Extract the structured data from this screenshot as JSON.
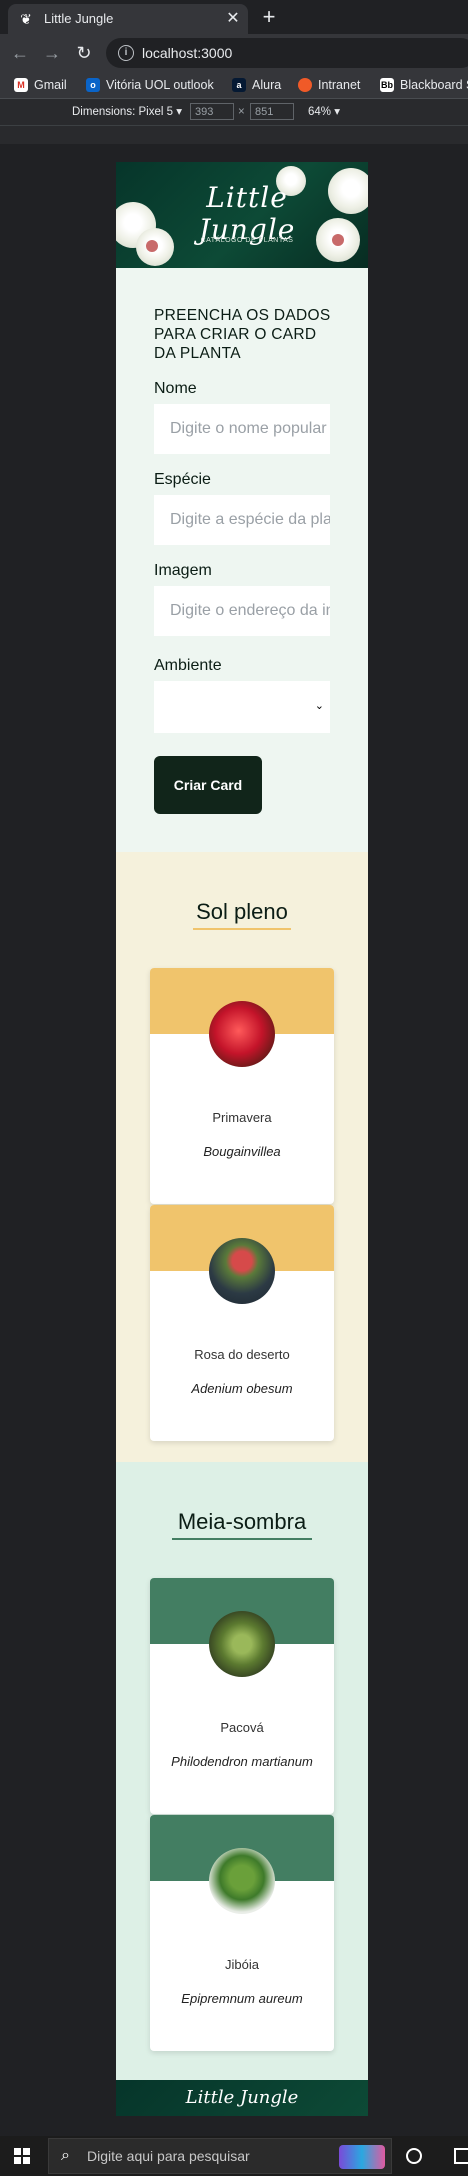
{
  "browser": {
    "tab_title": "Little Jungle",
    "url": "localhost:3000",
    "bookmarks": [
      "Gmail",
      "Vitória UOL outlook",
      "Alura",
      "Intranet",
      "Blackboard S"
    ]
  },
  "devtools": {
    "dimensions_label": "Dimensions: Pixel 5",
    "width": "393",
    "times": "×",
    "height": "851",
    "zoom": "64%"
  },
  "header": {
    "title": "Little Jungle",
    "subtitle": "CATÁLOGO DE PLANTAS"
  },
  "form": {
    "heading": "PREENCHA OS DADOS PARA CRIAR O CARD DA PLANTA",
    "name_label": "Nome",
    "name_placeholder": "Digite o nome popular",
    "species_label": "Espécie",
    "species_placeholder": "Digite a espécie da planta",
    "image_label": "Imagem",
    "image_placeholder": "Digite o endereço da imagem",
    "env_label": "Ambiente",
    "env_value": "",
    "submit_label": "Criar Card"
  },
  "sections": [
    {
      "title": "Sol pleno",
      "bg": "#f5f1dc",
      "accent": "#f0c46c",
      "cards": [
        {
          "name": "Primavera",
          "species": "Bougainvillea"
        },
        {
          "name": "Rosa do deserto",
          "species": "Adenium obesum"
        }
      ]
    },
    {
      "title": "Meia-sombra",
      "bg": "#ddf0e6",
      "accent": "#437e62",
      "cards": [
        {
          "name": "Pacová",
          "species": "Philodendron martianum"
        },
        {
          "name": "Jibóia",
          "species": "Epipremnum aureum"
        }
      ]
    }
  ],
  "footer": {
    "title": "Little Jungle"
  },
  "taskbar": {
    "search_placeholder": "Digite aqui para pesquisar"
  },
  "icons": [
    "windows-icon",
    "search-icon",
    "cortana-icon",
    "back-icon",
    "forward-icon",
    "reload-icon",
    "info-icon",
    "close-icon",
    "plus-icon",
    "chevron-down-icon"
  ]
}
